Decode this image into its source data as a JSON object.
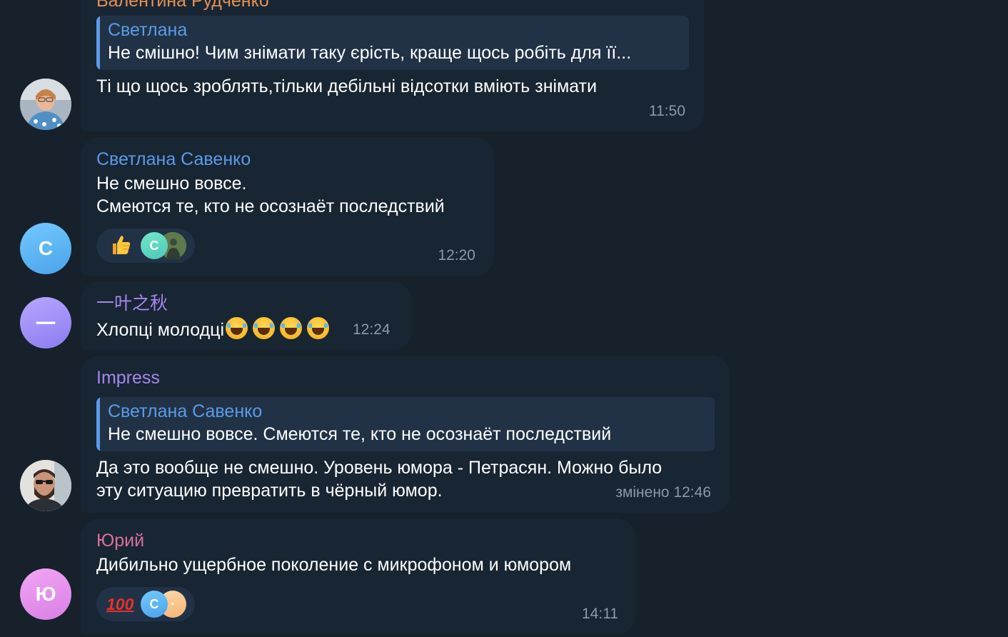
{
  "colors": {
    "background": "#17212b",
    "bubble": "#182533",
    "reply_bg": "#213246",
    "reply_accent": "#5b9be6",
    "time": "#8b9aa8",
    "name_orange": "#e29155",
    "name_blue": "#5b9be6",
    "name_violet": "#a786ee",
    "name_pink": "#d870a0"
  },
  "messages": [
    {
      "sender": "Валентина Рудченко",
      "reply": {
        "name": "Светлана",
        "text": "Не смішно! Чим знімати таку єрість, краще щось робіть для її..."
      },
      "text": "Ті що щось зроблять,тільки дебільні відсотки вміють знімати",
      "time": "11:50",
      "avatar_icon": "user-photo-icon"
    },
    {
      "sender": "Светлана Савенко",
      "text_lines": [
        "Не смешно вовсе.",
        "Смеются те, кто не осознаёт последствий"
      ],
      "reactions": {
        "emoji_icon": "thumbs-up-icon",
        "user_initial": "С"
      },
      "time": "12:20",
      "avatar_initial": "С"
    },
    {
      "sender": "一叶之秋",
      "text": "Хлопці молодці",
      "inline_emoji_icon": "laughing-tears-icon",
      "time": "12:24",
      "avatar_initial": "一"
    },
    {
      "sender": "Impress",
      "reply": {
        "name": "Светлана Савенко",
        "text": "Не смешно вовсе. Смеются те, кто не осознаёт последствий"
      },
      "text_lines": [
        "Да это вообще не смешно. Уровень юмора - Петрасян. Можно было",
        "эту ситуацию превратить в чёрный юмор."
      ],
      "time": "змінено 12:46",
      "avatar_icon": "user-photo-icon"
    },
    {
      "sender": "Юрий",
      "text": "Дибильно ущербное поколение с микрофоном и юмором",
      "reactions": {
        "emoji_icon": "hundred-points-icon",
        "emoji_text": "100",
        "user_initial": "С",
        "second_user_initial": "·"
      },
      "time": "14:11",
      "avatar_initial": "Ю"
    }
  ]
}
